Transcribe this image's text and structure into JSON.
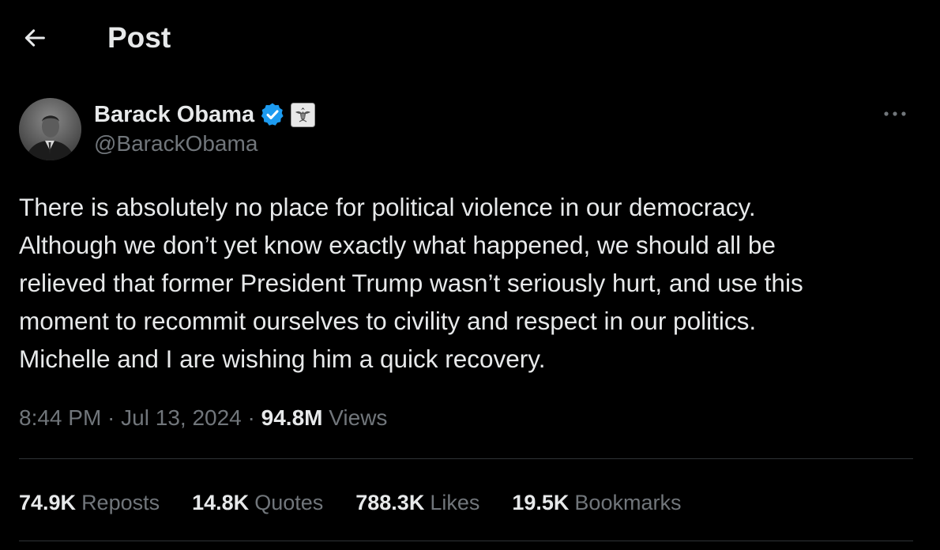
{
  "header": {
    "title": "Post",
    "back_icon": "arrow-left-icon"
  },
  "author": {
    "name": "Barack Obama",
    "handle": "@BarackObama",
    "verified_icon": "verified-badge-icon",
    "affiliation_icon": "government-seal-icon",
    "verified_color": "#1d9bf0"
  },
  "post": {
    "text": "There is absolutely no place for political violence in our democracy.\nAlthough we don’t yet know exactly what happened, we should all be\nrelieved that former President Trump wasn’t seriously hurt, and use this\nmoment to recommit ourselves to civility and respect in our politics.\nMichelle and I are wishing him a quick recovery."
  },
  "meta": {
    "time": "8:44 PM",
    "separator": " · ",
    "date": "Jul 13, 2024",
    "views_count": "94.8M",
    "views_label": "Views"
  },
  "stats": [
    {
      "count": "74.9K",
      "label": "Reposts"
    },
    {
      "count": "14.8K",
      "label": "Quotes"
    },
    {
      "count": "788.3K",
      "label": "Likes"
    },
    {
      "count": "19.5K",
      "label": "Bookmarks"
    }
  ],
  "colors": {
    "background": "#000000",
    "text_primary": "#e7e9ea",
    "text_secondary": "#71767b",
    "divider": "#2f3336"
  }
}
